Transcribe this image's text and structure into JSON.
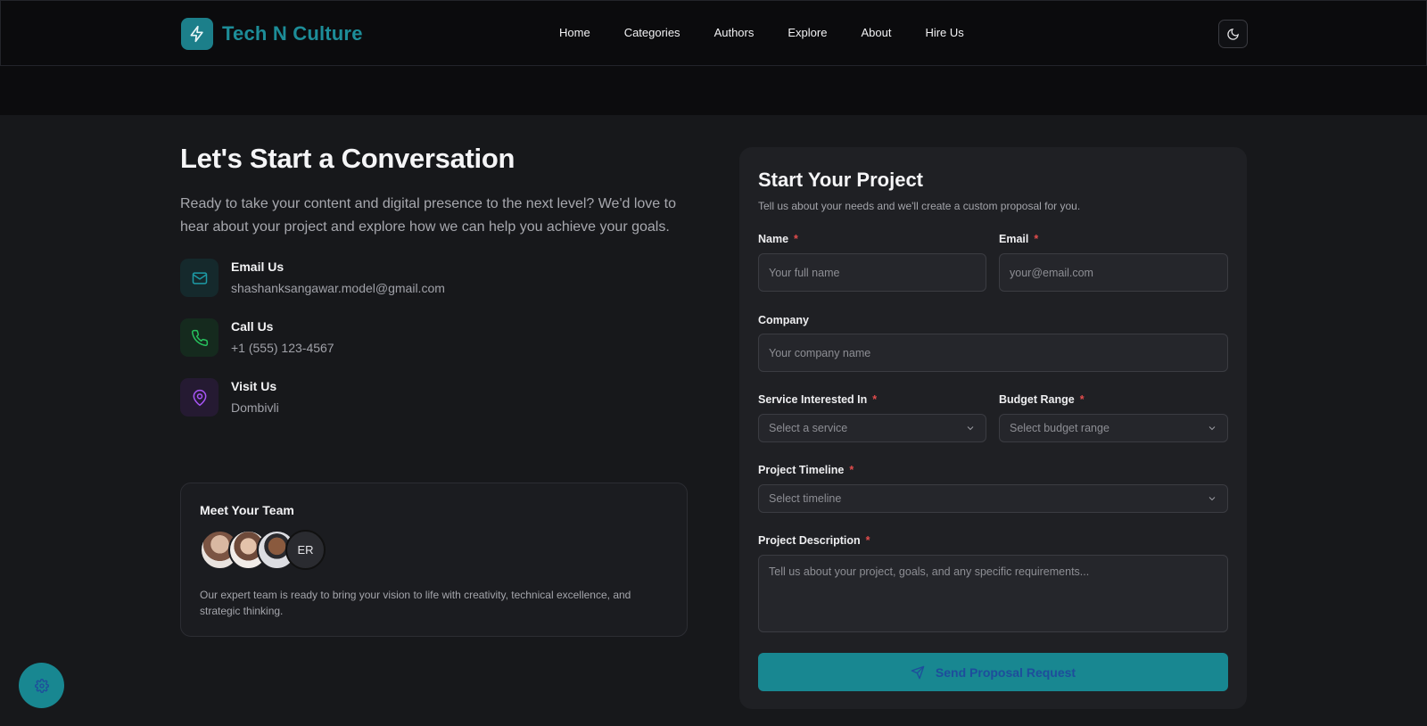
{
  "brand": {
    "name": "Tech N Culture",
    "logo_icon": "bolt-icon"
  },
  "nav": {
    "items": [
      "Home",
      "Categories",
      "Authors",
      "Explore",
      "About",
      "Hire Us"
    ]
  },
  "theme_toggle_icon": "moon-icon",
  "hero": {
    "title": "Let's Start a Conversation",
    "text": "Ready to take your content and digital presence to the next level? We'd love to hear about your project and explore how we can help you achieve your goals."
  },
  "contacts": [
    {
      "title": "Email Us",
      "value": "shashanksangawar.model@gmail.com",
      "icon": "mail-icon"
    },
    {
      "title": "Call Us",
      "value": "+1 (555) 123-4567",
      "icon": "phone-icon"
    },
    {
      "title": "Visit Us",
      "value": "Dombivli",
      "icon": "map-pin-icon"
    }
  ],
  "team": {
    "title": "Meet Your Team",
    "extra_initials": "ER",
    "text": "Our expert team is ready to bring your vision to life with creativity, technical excellence, and strategic thinking."
  },
  "form": {
    "title": "Start Your Project",
    "subtitle": "Tell us about your needs and we'll create a custom proposal for you.",
    "required_mark": "*",
    "name": {
      "label": "Name",
      "placeholder": "Your full name"
    },
    "email": {
      "label": "Email",
      "placeholder": "your@email.com"
    },
    "company": {
      "label": "Company",
      "placeholder": "Your company name"
    },
    "service": {
      "label": "Service Interested In",
      "placeholder": "Select a service"
    },
    "budget": {
      "label": "Budget Range",
      "placeholder": "Select budget range"
    },
    "timeline": {
      "label": "Project Timeline",
      "placeholder": "Select timeline"
    },
    "description": {
      "label": "Project Description",
      "placeholder": "Tell us about your project, goals, and any specific requirements..."
    },
    "submit_label": "Send Proposal Request",
    "submit_icon": "send-icon"
  },
  "settings_fab_icon": "gear-icon",
  "colors": {
    "accent": "#188791",
    "brand_text": "#1d8d98",
    "required": "#e24c4c"
  }
}
